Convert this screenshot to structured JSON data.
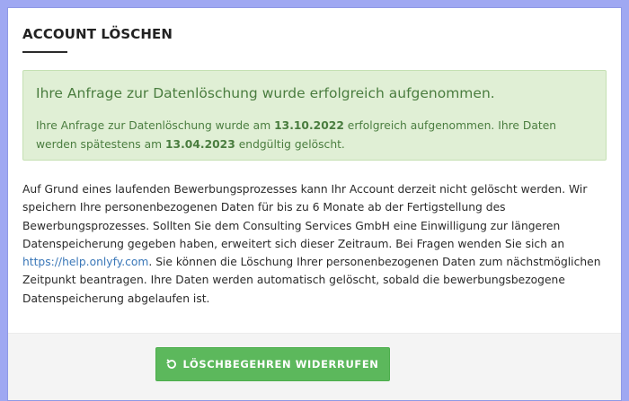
{
  "page": {
    "title": "ACCOUNT LÖSCHEN"
  },
  "alert": {
    "heading": "Ihre Anfrage zur Datenlöschung wurde erfolgreich aufgenommen.",
    "body_prefix": "Ihre Anfrage zur Datenlöschung wurde am ",
    "request_date": "13.10.2022",
    "body_middle": " erfolgreich aufgenommen. Ihre Daten werden spätestens am ",
    "deletion_date": "13.04.2023",
    "body_suffix": " endgültig gelöscht."
  },
  "content": {
    "text_before_link": "Auf Grund eines laufenden Bewerbungsprozesses kann Ihr Account derzeit nicht gelöscht werden. Wir speichern Ihre personenbezogenen Daten für bis zu 6 Monate ab der Fertigstellung des Bewerbungsprozesses. Sollten Sie dem Consulting Services GmbH eine Einwilligung zur längeren Datenspeicherung gegeben haben, erweitert sich dieser Zeitraum. Bei Fragen wenden Sie sich an ",
    "link_text": "https://help.onlyfy.com",
    "text_after_link": ". Sie können die Löschung Ihrer personenbezogenen Daten zum nächstmöglichen Zeitpunkt beantragen. Ihre Daten werden automatisch gelöscht, sobald die bewerbungsbezogene Datenspeicherung abgelaufen ist."
  },
  "footer": {
    "revoke_button_label": "LÖSCHBEGEHREN WIDERRUFEN",
    "revoke_button_icon": "undo-icon"
  },
  "colors": {
    "background": "#9fa8f2",
    "alert_background": "#e0efd5",
    "alert_text": "#4a7d3f",
    "button": "#5cb85c",
    "link": "#3a77b8"
  }
}
